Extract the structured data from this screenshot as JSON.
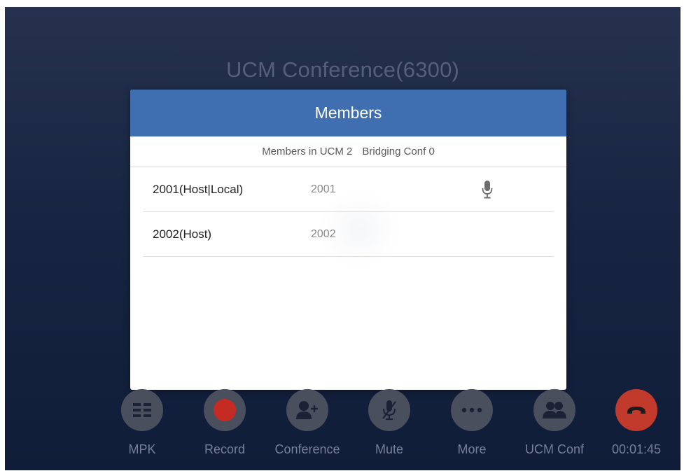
{
  "call": {
    "title": "UCM Conference(6300)"
  },
  "dialog": {
    "title": "Members",
    "summary": {
      "members_in_ucm": "Members in UCM 2",
      "bridging_conf": "Bridging Conf 0"
    },
    "members": [
      {
        "name": "2001(Host|Local)",
        "number": "2001",
        "icon": "microphone-icon"
      },
      {
        "name": "2002(Host)",
        "number": "2002"
      }
    ]
  },
  "toolbar": {
    "buttons": [
      {
        "label": "MPK",
        "icon": "grid-icon"
      },
      {
        "label": "Record",
        "icon": "record-icon"
      },
      {
        "label": "Conference",
        "icon": "add-person-icon"
      },
      {
        "label": "Mute",
        "icon": "mute-mic-icon"
      },
      {
        "label": "More",
        "icon": "more-dots-icon"
      },
      {
        "label": "UCM Conf",
        "icon": "group-icon"
      },
      {
        "label": "00:01:45",
        "icon": "hangup-icon"
      }
    ]
  },
  "colors": {
    "header_blue": "#3f6fb0",
    "record_red": "#c42b22",
    "hangup_red": "#c23a2c",
    "button_gray": "#4a4f5e",
    "background_navy": "#172542"
  }
}
